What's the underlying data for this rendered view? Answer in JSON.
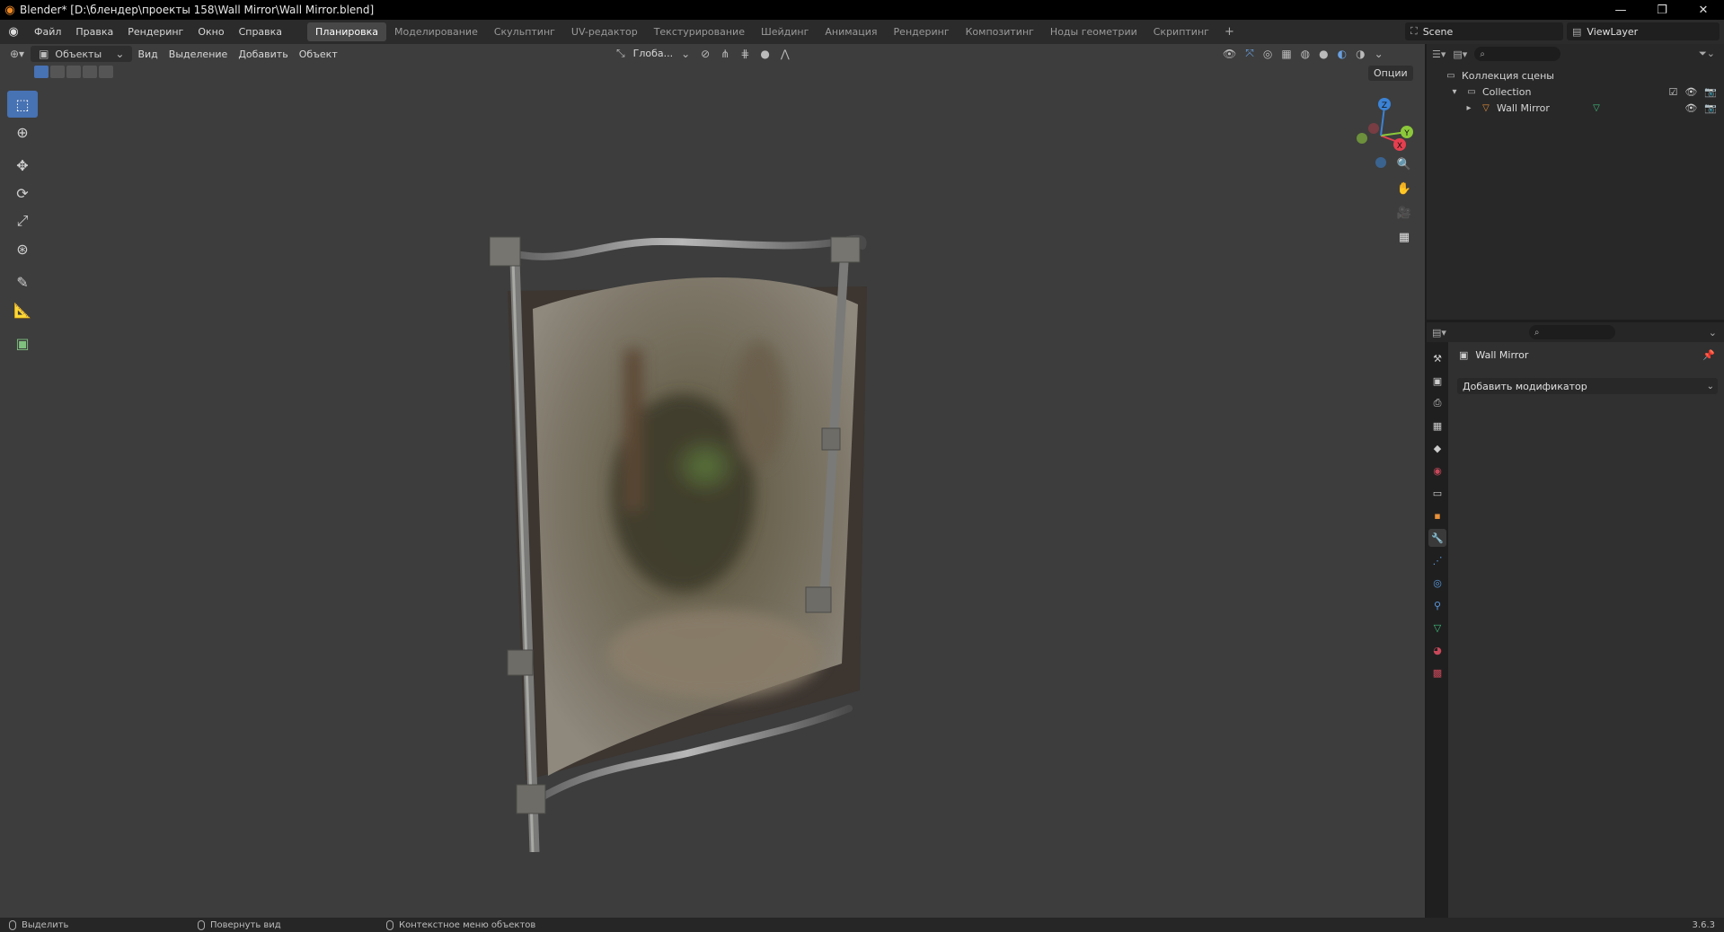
{
  "window": {
    "title": "Blender* [D:\\блендер\\проекты 158\\Wall Mirror\\Wall Mirror.blend]",
    "controls": [
      "minimize",
      "maximize",
      "close"
    ]
  },
  "menu": [
    "Файл",
    "Правка",
    "Рендеринг",
    "Окно",
    "Справка"
  ],
  "workspaces": [
    {
      "label": "Планировка",
      "active": true
    },
    {
      "label": "Моделирование",
      "active": false
    },
    {
      "label": "Скульптинг",
      "active": false
    },
    {
      "label": "UV-редактор",
      "active": false
    },
    {
      "label": "Текстурирование",
      "active": false
    },
    {
      "label": "Шейдинг",
      "active": false
    },
    {
      "label": "Анимация",
      "active": false
    },
    {
      "label": "Рендеринг",
      "active": false
    },
    {
      "label": "Композитинг",
      "active": false
    },
    {
      "label": "Ноды геометрии",
      "active": false
    },
    {
      "label": "Скриптинг",
      "active": false
    }
  ],
  "workspaces_add": "+",
  "scene": {
    "name": "Scene"
  },
  "view_layer": {
    "name": "ViewLayer"
  },
  "viewport": {
    "mode": "Объекты",
    "menus": [
      "Вид",
      "Выделение",
      "Добавить",
      "Объект"
    ],
    "transform_orientation": "Глоба...",
    "options_label": "Опции",
    "gizmo_axes": [
      "X",
      "Y",
      "Z"
    ]
  },
  "tools": [
    {
      "name": "select-box-tool",
      "icon": "cursor-box-icon",
      "active": true
    },
    {
      "name": "cursor-tool",
      "icon": "crosshair-icon",
      "active": false
    },
    {
      "name": "move-tool",
      "icon": "move-icon",
      "active": false
    },
    {
      "name": "rotate-tool",
      "icon": "rotate-icon",
      "active": false
    },
    {
      "name": "scale-tool",
      "icon": "scale-icon",
      "active": false
    },
    {
      "name": "transform-tool",
      "icon": "transform-icon",
      "active": false
    },
    {
      "name": "annotate-tool",
      "icon": "pencil-icon",
      "active": false
    },
    {
      "name": "measure-tool",
      "icon": "ruler-icon",
      "active": false
    },
    {
      "name": "add-cube-tool",
      "icon": "cube-add-icon",
      "active": false
    }
  ],
  "outliner": {
    "root": "Коллекция сцены",
    "collection": "Collection",
    "object": "Wall Mirror"
  },
  "properties": {
    "object_name": "Wall Mirror",
    "add_modifier": "Добавить модификатор",
    "tabs": [
      "tool",
      "render",
      "output",
      "view-layer",
      "scene",
      "world",
      "collection",
      "object",
      "modifiers",
      "particles",
      "physics",
      "constraints",
      "data",
      "material",
      "texture"
    ]
  },
  "statusbar": {
    "select": "Выделить",
    "rotate_view": "Повернуть вид",
    "context_menu": "Контекстное меню объектов",
    "version": "3.6.3"
  },
  "colors": {
    "accent": "#4772b3",
    "viewport_bg": "#3d3d3d",
    "axis_x": "#e53f4f",
    "axis_y": "#8cc83a",
    "axis_z": "#3b83d6"
  }
}
